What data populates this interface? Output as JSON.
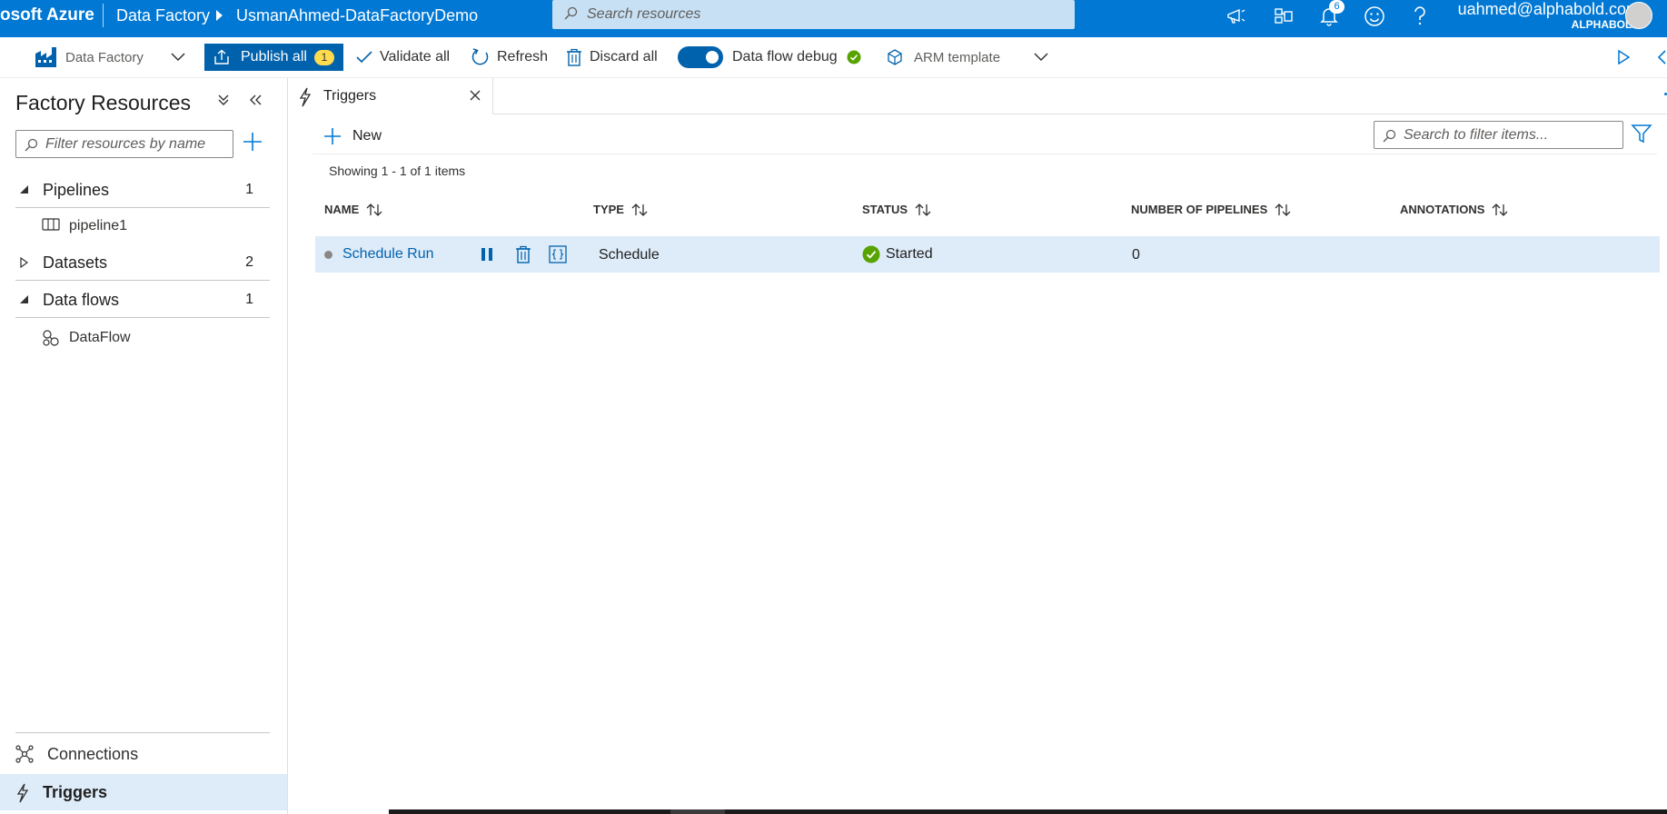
{
  "topbar": {
    "brand": "osoft Azure",
    "service": "Data Factory",
    "factory_name": "UsmanAhmed-DataFactoryDemo",
    "search_placeholder": "Search resources",
    "notification_count": "6",
    "user_email": "uahmed@alphabold.com",
    "user_org": "ALPHABOLD",
    "icons": [
      "feedback-megaphone-icon",
      "directory-filter-icon",
      "bell-icon",
      "smiley-icon",
      "help-icon"
    ]
  },
  "toolbar": {
    "factory_label": "Data Factory",
    "publish_label": "Publish all",
    "publish_count": "1",
    "validate_label": "Validate all",
    "refresh_label": "Refresh",
    "discard_label": "Discard all",
    "debug_label": "Data flow debug",
    "arm_label": "ARM template"
  },
  "sidebar": {
    "title": "Factory Resources",
    "filter_placeholder": "Filter resources by name",
    "groups": [
      {
        "label": "Pipelines",
        "count": "1",
        "expanded": true,
        "children": [
          "pipeline1"
        ]
      },
      {
        "label": "Datasets",
        "count": "2",
        "expanded": false,
        "children": []
      },
      {
        "label": "Data flows",
        "count": "1",
        "expanded": true,
        "children": [
          "DataFlow"
        ]
      }
    ],
    "nav": [
      {
        "label": "Connections",
        "icon": "connections-icon"
      },
      {
        "label": "Triggers",
        "icon": "bolt-icon",
        "active": true
      }
    ]
  },
  "tab": {
    "label": "Triggers"
  },
  "triggers": {
    "new_label": "New",
    "search_placeholder": "Search to filter items...",
    "showing_text": "Showing 1 - 1 of 1 items",
    "columns": [
      "NAME",
      "TYPE",
      "STATUS",
      "NUMBER OF PIPELINES",
      "ANNOTATIONS"
    ],
    "rows": [
      {
        "name": "Schedule Run",
        "type": "Schedule",
        "status": "Started",
        "pipelines": "0",
        "annotations": ""
      }
    ]
  },
  "colors": {
    "azure_blue": "#0078d4",
    "publish_blue": "#0062ad",
    "badge_yellow": "#ffdb4d",
    "status_green": "#57a300",
    "selection_blue": "#deecf9"
  }
}
